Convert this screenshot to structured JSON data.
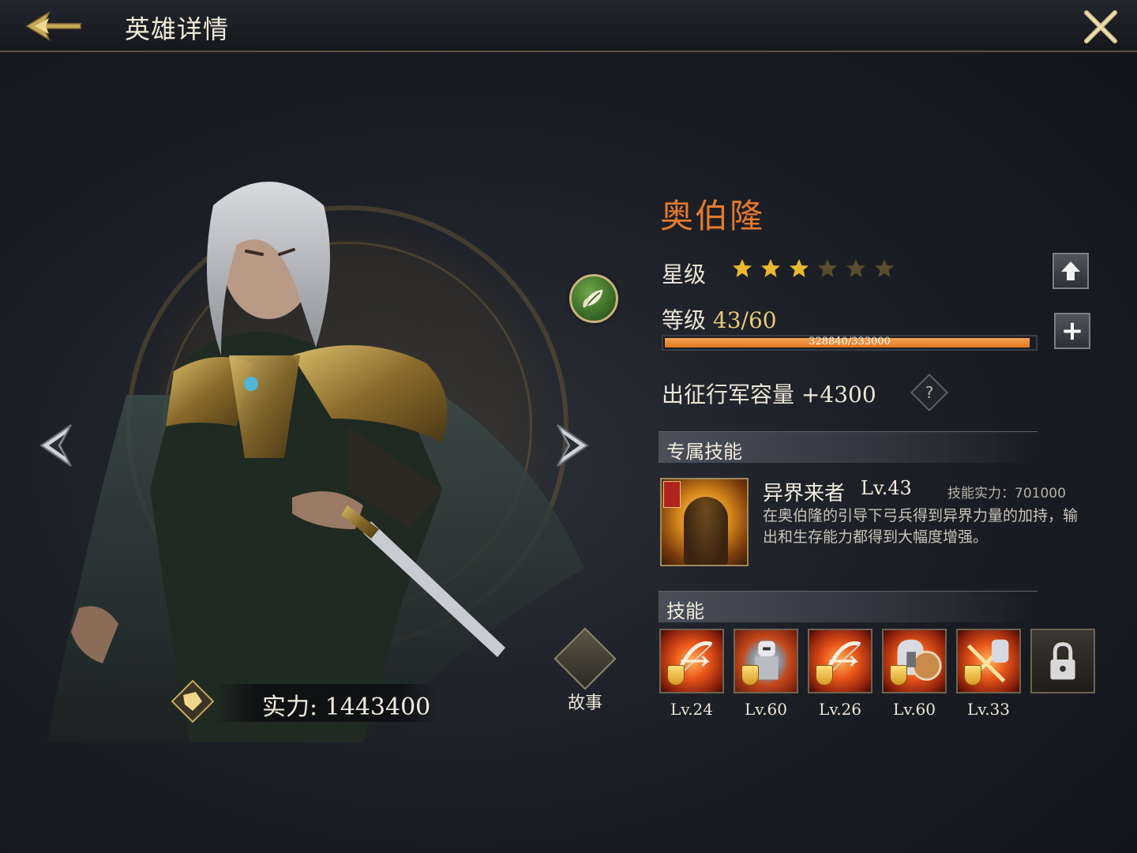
{
  "header": {
    "title": "英雄详情"
  },
  "hero": {
    "name": "奥伯隆",
    "power_label": "实力: 1443400",
    "story_label": "故事"
  },
  "stats": {
    "star_label": "星级",
    "stars_filled": 3,
    "stars_total": 6,
    "level_label": "等级",
    "level_value": "43/60",
    "xp_text": "328840/333000",
    "xp_fraction": 0.9875,
    "march_label": "出征行军容量",
    "march_value": "+4300",
    "help_icon": "?"
  },
  "exclusive_skill": {
    "header": "专属技能",
    "name": "异界来者",
    "level": "Lv.43",
    "power": "技能实力：701000",
    "description": "在奥伯隆的引导下弓兵得到异界力量的加持，输出和生存能力都得到大幅度增强。"
  },
  "skills": {
    "header": "技能",
    "items": [
      {
        "level": "Lv.24",
        "icon": "bow-icon",
        "style": "fire"
      },
      {
        "level": "Lv.60",
        "icon": "knight-icon",
        "style": "gray"
      },
      {
        "level": "Lv.26",
        "icon": "bow-icon",
        "style": "fire"
      },
      {
        "level": "Lv.60",
        "icon": "helmet-shield-icon",
        "style": "fire"
      },
      {
        "level": "Lv.33",
        "icon": "crossed-swords-icon",
        "style": "fire"
      },
      {
        "level": "",
        "icon": "lock-icon",
        "style": "locked"
      }
    ]
  },
  "colors": {
    "name_orange": "#e47a2c",
    "xp_bar": "#e0751f",
    "star_gold": "#e8b830",
    "star_empty": "#5a4d2e"
  }
}
